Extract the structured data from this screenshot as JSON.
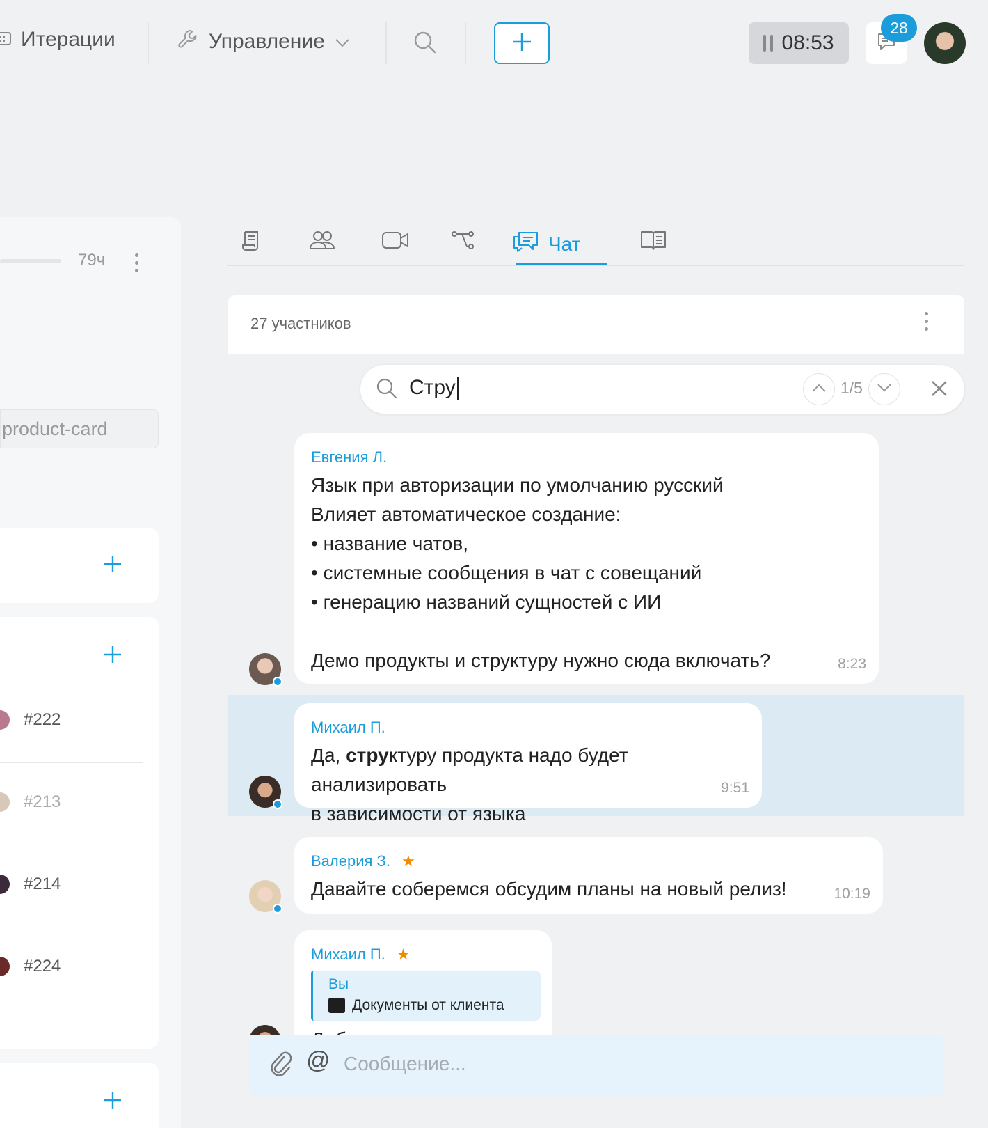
{
  "topbar": {
    "iterations_label": "Итерации",
    "management_label": "Управление",
    "timer": "08:53",
    "notifications_count": "28"
  },
  "left_panel": {
    "hours": "79ч",
    "branch": "product-card",
    "tasks": [
      {
        "id": "#222"
      },
      {
        "id": "#213"
      },
      {
        "id": "#214"
      },
      {
        "id": "#224"
      }
    ]
  },
  "tabs": {
    "chat_label": "Чат"
  },
  "chat": {
    "participants": "27 участников",
    "search": {
      "query": "Стру",
      "counter": "1/5"
    },
    "messages": [
      {
        "author": "Евгения Л.",
        "lines": [
          "Язык при авторизации по умолчанию русский",
          "Влияет автоматическое создание:",
          "• название чатов,",
          "• системные сообщения в чат с совещаний",
          "• генерацию названий сущностей с ИИ",
          "",
          "Демо продукты и структуру нужно сюда включать?"
        ],
        "time": "8:23"
      },
      {
        "author": "Михаил П.",
        "pre": "Да, ",
        "match": "стру",
        "post": "ктуру продукта надо будет анализировать",
        "line2": "в зависимости от языка",
        "time": "9:51"
      },
      {
        "author": "Валерия З.",
        "star": "★",
        "text": "Давайте соберемся обсудим планы на новый релиз!",
        "time": "10:19"
      },
      {
        "author": "Михаил П.",
        "star": "★",
        "quote_author": "Вы",
        "quote_doc": "Документы от клиента",
        "text": "Добавь в задачу"
      }
    ],
    "composer_placeholder": "Сообщение...",
    "at_symbol": "@"
  },
  "colors": {
    "accent": "#1B9CDB",
    "star": "#F08A00",
    "highlight": "#DCEAF4",
    "background": "#F0F1F3"
  },
  "icons": [
    "calendar-icon",
    "wrench-icon",
    "chevron-down-icon",
    "search-icon",
    "plus-icon",
    "pause-icon",
    "chat-icon",
    "scroll-icon",
    "people-icon",
    "video-icon",
    "flow-icon",
    "book-icon",
    "close-icon",
    "paperclip-icon"
  ]
}
